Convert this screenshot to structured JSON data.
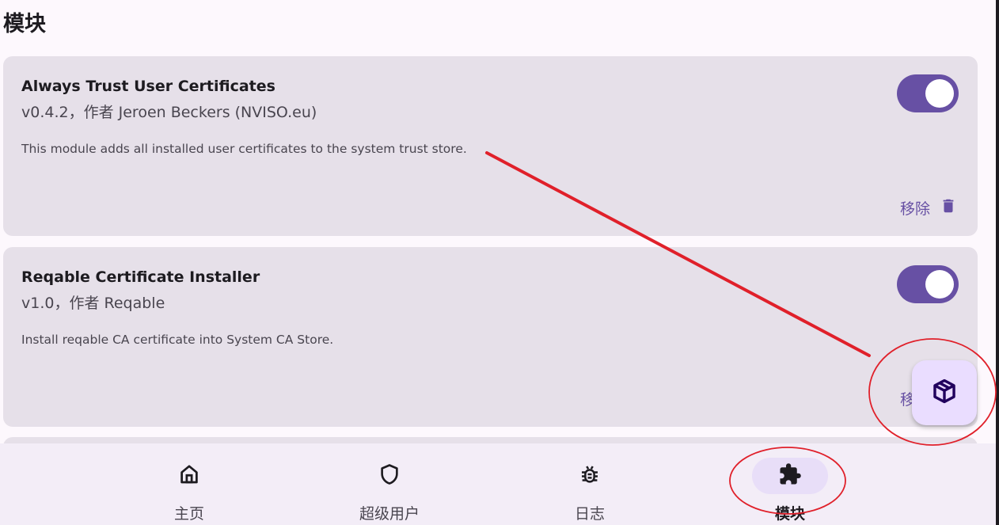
{
  "header": {
    "title": "模块"
  },
  "modules": [
    {
      "name": "Always Trust User Certificates",
      "meta": "v0.4.2，作者 Jeroen Beckers (NVISO.eu)",
      "description": "This module adds all installed user certificates to the system trust store.",
      "enabled": true,
      "remove_label": "移除"
    },
    {
      "name": "Reqable Certificate Installer",
      "meta": "v1.0，作者 Reqable",
      "description": "Install reqable CA certificate into System CA Store.",
      "enabled": true,
      "remove_label": "移除"
    }
  ],
  "fab": {
    "icon": "cube-install-icon"
  },
  "bottom_nav": {
    "items": [
      {
        "label": "主页",
        "icon": "home-icon",
        "active": false
      },
      {
        "label": "超级用户",
        "icon": "shield-icon",
        "active": false
      },
      {
        "label": "日志",
        "icon": "bug-icon",
        "active": false
      },
      {
        "label": "模块",
        "icon": "puzzle-icon",
        "active": true
      }
    ]
  },
  "colors": {
    "accent": "#6750a4",
    "card_bg": "#e6e0e9",
    "annotation_red": "#e0202a"
  }
}
